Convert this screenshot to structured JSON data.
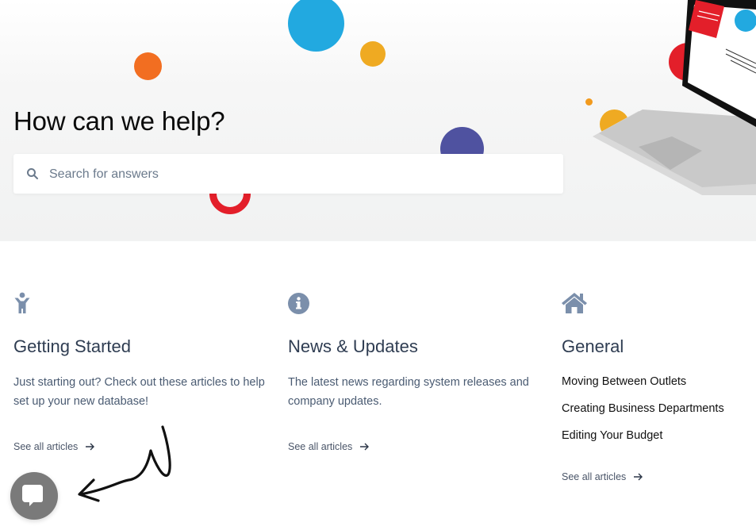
{
  "hero": {
    "title": "How can we help?",
    "search_placeholder": "Search for answers",
    "search_value": "",
    "search_icon": "search-icon"
  },
  "categories": [
    {
      "icon": "child-icon",
      "title": "Getting Started",
      "description": "Just starting out? Check out these articles to help set up your new database!",
      "see_all": "See all articles"
    },
    {
      "icon": "info-circle-icon",
      "title": "News & Updates",
      "description": "The latest news regarding system releases and company updates.",
      "see_all": "See all articles"
    },
    {
      "icon": "home-icon",
      "title": "General",
      "articles": [
        "Moving Between Outlets",
        "Creating Business Departments",
        "Editing Your Budget"
      ],
      "see_all": "See all articles"
    }
  ],
  "chat": {
    "icon": "chat-bubble-icon"
  },
  "colors": {
    "icon": "#7b8fab",
    "heading": "#2f3d52",
    "blue_dot": "#22a9e0",
    "orange_dot": "#f26e21",
    "yellow_dot": "#efaa22",
    "navy_dot": "#4f52a0",
    "red": "#e31f2a"
  }
}
